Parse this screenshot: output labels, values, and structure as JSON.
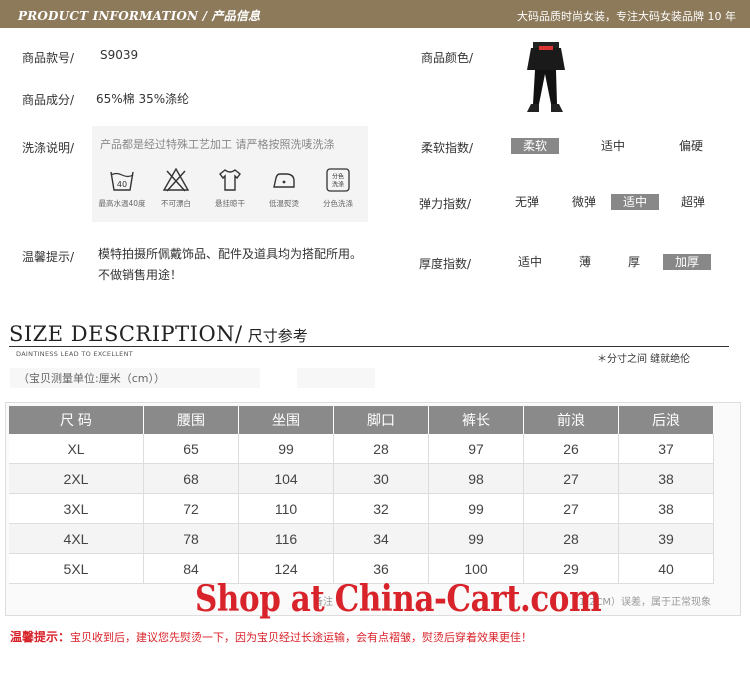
{
  "header": {
    "title": "PRODUCT INFORMATION / 产品信息",
    "tagline": "大码品质时尚女装，专注大码女装品牌 10 年"
  },
  "product": {
    "sku_label": "商品款号/",
    "sku_value": "S9039",
    "material_label": "商品成分/",
    "material_value": "65%棉 35%涤纶",
    "wash_label": "洗涤说明/",
    "wash_header": "产品都是经过特殊工艺加工 请严格按照洗唛洗涤",
    "wash_icons": [
      {
        "icon": "wash-40-icon",
        "caption": "最高水温40度",
        "glyph": "40"
      },
      {
        "icon": "no-bleach-icon",
        "caption": "不可漂白"
      },
      {
        "icon": "hang-dry-icon",
        "caption": "悬挂晾干"
      },
      {
        "icon": "low-iron-icon",
        "caption": "低温熨烫"
      },
      {
        "icon": "separate-wash-icon",
        "caption": "分色洗涤",
        "glyph": "分色洗涤"
      }
    ],
    "tips_label": "温馨提示/",
    "tips_line1": "模特拍摄所佩戴饰品、配件及道具均为搭配所用。",
    "tips_line2": "不做销售用途！",
    "color_label": "商品颜色/"
  },
  "scales": {
    "softness": {
      "label": "柔软指数/",
      "options": [
        "柔软",
        "适中",
        "偏硬"
      ],
      "selected": "柔软"
    },
    "elasticity": {
      "label": "弹力指数/",
      "options": [
        "无弹",
        "微弹",
        "适中",
        "超弹"
      ],
      "selected": "适中"
    },
    "thickness": {
      "label": "厚度指数/",
      "options": [
        "适中",
        "薄",
        "厚",
        "加厚"
      ],
      "selected": "加厚"
    }
  },
  "size_section": {
    "heading_en": "SIZE DESCRIPTION/",
    "heading_cn": "尺寸参考",
    "subtitle": "DAINTINESS LEAD TO EXCELLENT",
    "note": "＊分寸之间 缝就绝伦",
    "unit": "（宝贝测量单位:厘米（cm））",
    "columns": [
      "尺 码",
      "腰围",
      "坐围",
      "脚口",
      "裤长",
      "前浪",
      "后浪"
    ],
    "rows": [
      [
        "XL",
        "65",
        "99",
        "28",
        "97",
        "26",
        "37"
      ],
      [
        "2XL",
        "68",
        "104",
        "30",
        "98",
        "27",
        "38"
      ],
      [
        "3XL",
        "72",
        "110",
        "32",
        "99",
        "27",
        "38"
      ],
      [
        "4XL",
        "78",
        "116",
        "34",
        "99",
        "28",
        "39"
      ],
      [
        "5XL",
        "84",
        "124",
        "36",
        "100",
        "29",
        "40"
      ]
    ],
    "note_left": "备注",
    "note_right": "1-2CM）误差，属于正常现象"
  },
  "watermark": "Shop at China-Cart.com",
  "warm_tip": {
    "label": "温馨提示：",
    "text": "宝贝收到后，建议您先熨烫一下，因为宝贝经过长途运输，会有点褶皱，熨烫后穿着效果更佳！"
  }
}
